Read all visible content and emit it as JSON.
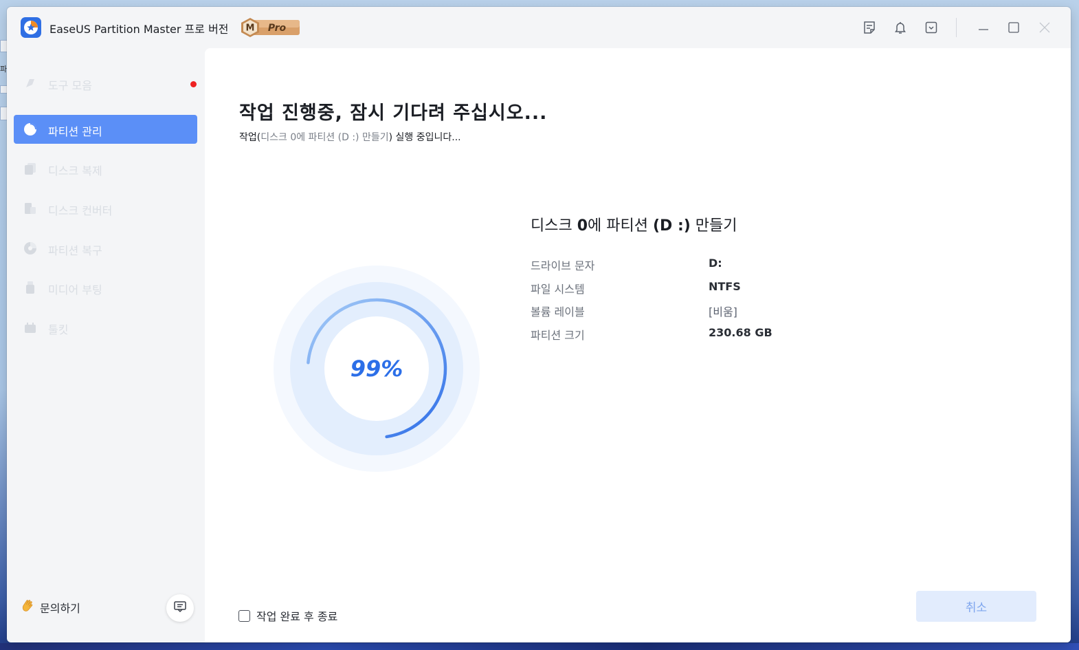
{
  "window": {
    "title": "EaseUS Partition Master 프로 버전",
    "badge": "Pro",
    "badge_letter": "M"
  },
  "titlebar_icons": [
    "notes-icon",
    "bell-icon",
    "menu-dropdown-icon",
    "minimize-icon",
    "maximize-icon",
    "close-icon"
  ],
  "sidebar": {
    "items": [
      {
        "label": "도구 모음",
        "icon": "toolbox-icon",
        "has_dot": true
      },
      {
        "label": "파티션 관리",
        "icon": "pie-icon",
        "active": true
      },
      {
        "label": "디스크 복제",
        "icon": "copy-icon"
      },
      {
        "label": "디스크 컨버터",
        "icon": "convert-icon"
      },
      {
        "label": "파티션 복구",
        "icon": "recovery-icon"
      },
      {
        "label": "미디어 부팅",
        "icon": "usb-icon"
      },
      {
        "label": "툴킷",
        "icon": "toolkit-icon"
      }
    ],
    "help_label": "문의하기"
  },
  "main": {
    "heading": "작업 진행중, 잠시 기다려 주십시오...",
    "sub_prefix": "작업(",
    "sub_task": "디스크 0에 파티션 (D :) 만들기",
    "sub_suffix": ") 실행 중입니다...",
    "progress": {
      "value": 0.99,
      "label": "99%"
    },
    "op_title_pre": "디스크 ",
    "op_title_disk": "0",
    "op_title_mid": "에 파티션 ",
    "op_title_part": "(D :)",
    "op_title_post": " 만들기",
    "details": [
      {
        "key": "드라이브 문자",
        "value": "D:"
      },
      {
        "key": "파일 시스템",
        "value": "NTFS"
      },
      {
        "key": "볼륨 레이블",
        "value": "[비움]"
      },
      {
        "key": "파티션 크기",
        "value": "230.68 GB"
      }
    ],
    "shutdown_label": "작업 완료 후 종료",
    "cancel_label": "취소"
  },
  "colors": {
    "accent": "#5b8ff7",
    "progress": "#2c6fe8",
    "cancel_bg": "#e2ecfd"
  }
}
